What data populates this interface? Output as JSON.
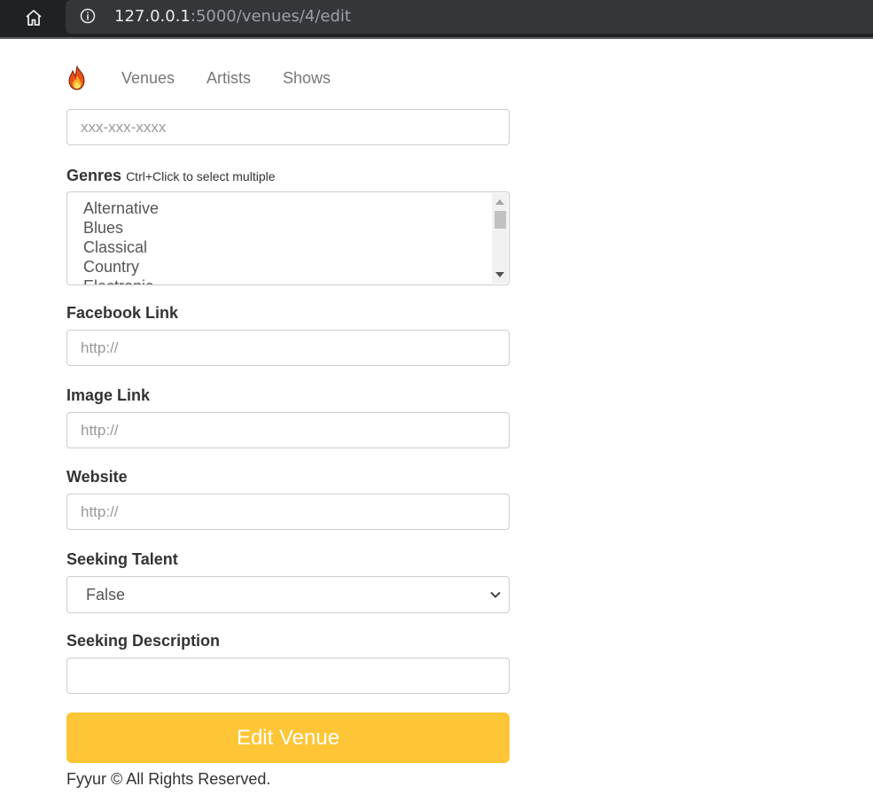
{
  "browser": {
    "url_host": "127.0.0.1",
    "url_rest": ":5000/venues/4/edit",
    "icons": [
      "home-icon",
      "info-icon"
    ]
  },
  "nav": {
    "logo_icon": "fire-icon",
    "links": [
      "Venues",
      "Artists",
      "Shows"
    ]
  },
  "form": {
    "phone": {
      "placeholder": "xxx-xxx-xxxx",
      "value": ""
    },
    "genres": {
      "label": "Genres",
      "hint": "Ctrl+Click to select multiple",
      "options": [
        "Alternative",
        "Blues",
        "Classical",
        "Country",
        "Electronic"
      ]
    },
    "facebook_link": {
      "label": "Facebook Link",
      "placeholder": "http://"
    },
    "image_link": {
      "label": "Image Link",
      "placeholder": "http://"
    },
    "website": {
      "label": "Website",
      "placeholder": "http://"
    },
    "seeking_talent": {
      "label": "Seeking Talent",
      "selected": "False"
    },
    "seeking_description": {
      "label": "Seeking Description",
      "value": ""
    },
    "submit_label": "Edit Venue"
  },
  "footer": "Fyyur © All Rights Reserved.",
  "colors": {
    "accent": "#fec636",
    "chrome": "#202124"
  }
}
